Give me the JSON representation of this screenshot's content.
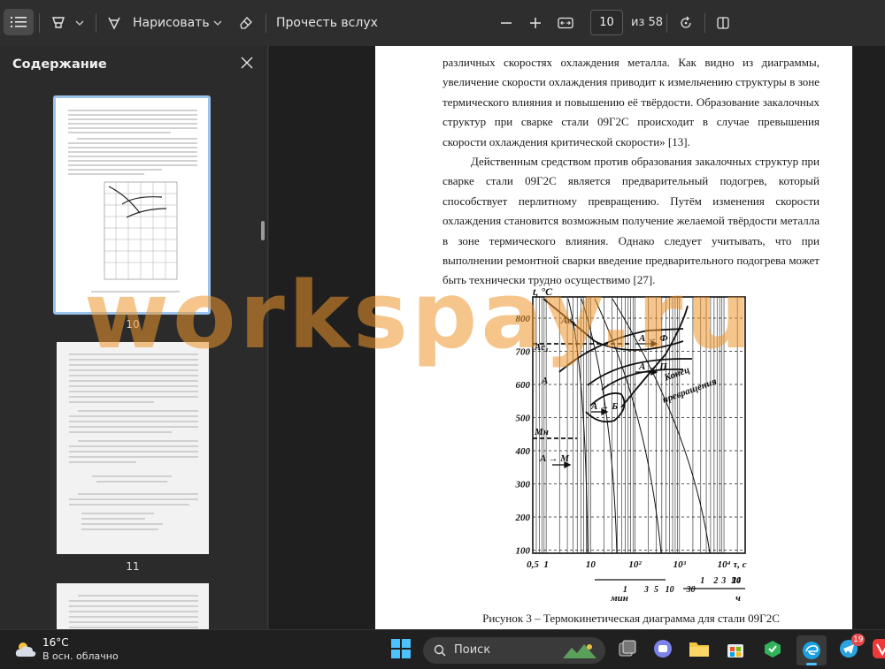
{
  "toolbar": {
    "contents_icon": "list-icon",
    "highlight_icon": "highlighter-icon",
    "draw_label": "Нарисовать",
    "eraser_icon": "eraser-icon",
    "read_aloud_label": "Прочесть вслух",
    "zoom_out_icon": "minus-icon",
    "zoom_in_icon": "plus-icon",
    "fit_icon": "fit-width-icon",
    "page_value": "10",
    "page_total": "из 58",
    "rotate_icon": "rotate-icon",
    "view_icon": "page-view-icon"
  },
  "sidebar": {
    "title": "Содержание",
    "close_icon": "close-icon",
    "pages": [
      {
        "number": "10",
        "selected": true
      },
      {
        "number": "11",
        "selected": false
      },
      {
        "number": "",
        "selected": false
      }
    ]
  },
  "document": {
    "paragraph1": "различных скоростях охлаждения металла. Как видно из диаграммы, увеличение скорости охлаждения приводит к измельчению структуры в зоне термического влияния и повышению её твёрдости. Образование закалочных структур при сварке стали 09Г2С происходит в случае превышения скорости охлаждения критической скорости» [13].",
    "paragraph2": "Действенным средством против образования закалочных структур при сварке стали 09Г2С является предварительный подогрев, который способствует перлитному превращению. Путём изменения скорости охлаждения становится возможным получение желаемой твёрдости металла в зоне термического влияния. Однако следует учитывать, что при выполнении ремонтной сварки введение предварительного подогрева может быть технически трудно осуществимо [27].",
    "caption": "Рисунок 3 – Термокинетическая диаграмма для стали 09Г2С",
    "figure": {
      "y_axis_label": "t, °C",
      "y_ticks": [
        "800",
        "700",
        "600",
        "500",
        "400",
        "300",
        "200",
        "100"
      ],
      "x_ticks": [
        "0,5",
        "1",
        "10",
        "10²",
        "10³",
        "10⁴",
        "τ, c"
      ],
      "x_ticks_min": [
        "1",
        "3",
        "5",
        "10",
        "30"
      ],
      "x_min_label": "мин",
      "x_hours_ticks": [
        "1",
        "2",
        "3",
        "5",
        "10",
        "24"
      ],
      "x_hours_label": "ч",
      "labels": {
        "ac3": "Ac₃",
        "ac1": "Ac₁",
        "mn": "Mн",
        "a": "A",
        "a_f": "A → Ф",
        "a_p": "A → П",
        "a_b": "A → Б",
        "a_m": "A → M",
        "end1": "Конец",
        "end2": "превращения"
      }
    }
  },
  "watermark": "workspay.ru",
  "taskbar": {
    "temperature": "16°C",
    "weather": "В осн. облачно",
    "search_placeholder": "Поиск",
    "badge": "19"
  }
}
